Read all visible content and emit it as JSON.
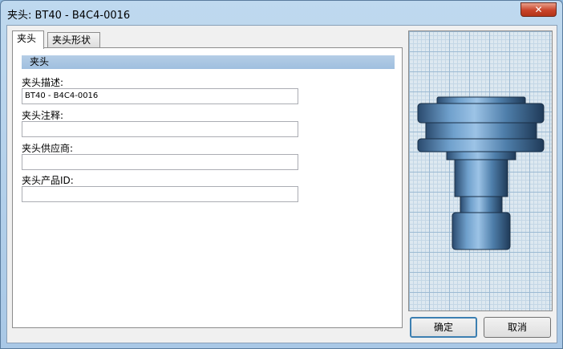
{
  "window": {
    "title": "夹头: BT40 - B4C4-0016",
    "close_glyph": "✕"
  },
  "tabs": [
    {
      "label": "夹头",
      "active": true
    },
    {
      "label": "夹头形状",
      "active": false
    }
  ],
  "section": {
    "title": "夹头"
  },
  "fields": {
    "description": {
      "label": "夹头描述:",
      "value": "BT40 - B4C4-0016"
    },
    "comment": {
      "label": "夹头注释:",
      "value": ""
    },
    "supplier": {
      "label": "夹头供应商:",
      "value": ""
    },
    "product_id": {
      "label": "夹头产品ID:",
      "value": ""
    }
  },
  "buttons": {
    "ok": "确定",
    "cancel": "取消"
  },
  "preview": {
    "icon": "holder-3d-preview",
    "grid_color": "#9cbad3",
    "part_color": "#4a7aa8"
  }
}
